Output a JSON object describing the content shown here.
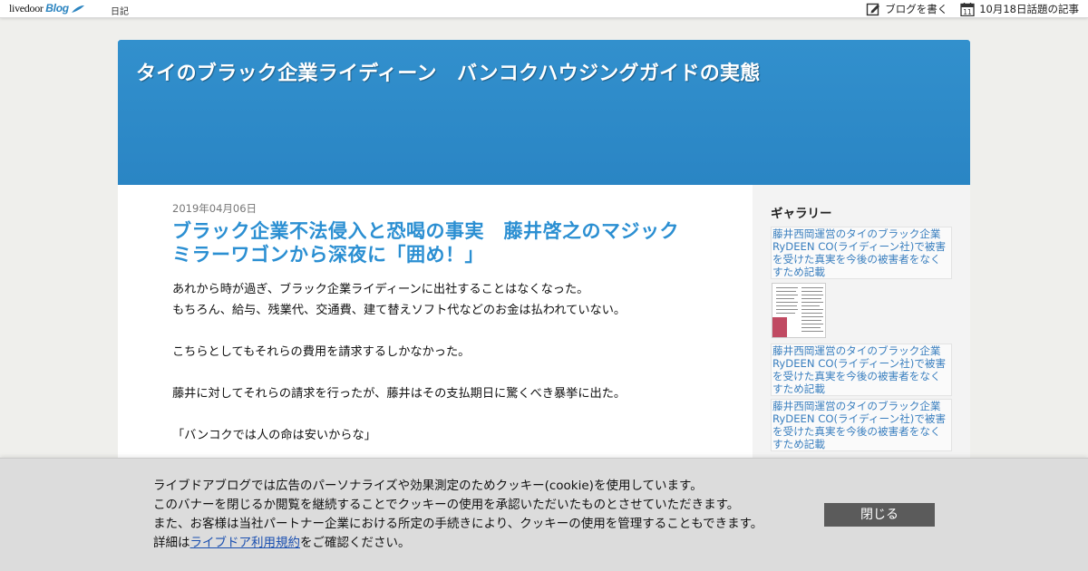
{
  "topbar": {
    "logo_text": "livedoor",
    "logo_blog": "Blog",
    "nav_diary": "日記",
    "write_blog": "ブログを書く",
    "calendar_day": "11",
    "trending": "10月18日話題の記事"
  },
  "blog": {
    "title": "タイのブラック企業ライディーン　バンコクハウジングガイドの実態"
  },
  "post": {
    "date": "2019年04月06日",
    "title": "ブラック企業不法侵入と恐喝の事実　藤井啓之のマジックミラーワゴンから深夜に「囲め！」",
    "body": [
      "あれから時が過ぎ、ブラック企業ライディーンに出社することはなくなった。",
      "もちろん、給与、残業代、交通費、建て替えソフト代などのお金は払われていない。",
      "",
      "こちらとしてもそれらの費用を請求するしかなかった。",
      "",
      "藤井に対してそれらの請求を行ったが、藤井はその支払期日に驚くべき暴挙に出た。",
      "",
      "「バンコクでは人の命は安いからな」"
    ]
  },
  "sidebar": {
    "heading": "ギャラリー",
    "gallery_alt": "藤井西岡運営のタイのブラック企業RyDEEN CO(ライディーン社)で被害を受けた真実を今後の被害者をなくすため記載"
  },
  "cookie": {
    "line1": "ライブドアブログでは広告のパーソナライズや効果測定のためクッキー(cookie)を使用しています。",
    "line2": "このバナーを閉じるか閲覧を継続することでクッキーの使用を承認いただいたものとさせていただきます。",
    "line3": "また、お客様は当社パートナー企業における所定の手続きにより、クッキーの使用を管理することもできます。",
    "line4_prefix": "詳細は",
    "line4_link": "ライブドア利用規約",
    "line4_suffix": "をご確認ください。",
    "close_label": "閉じる"
  },
  "colors": {
    "header_blue": "#2a85c4",
    "title_blue": "#2b8fd2",
    "close_button": "#5b5b5b"
  }
}
